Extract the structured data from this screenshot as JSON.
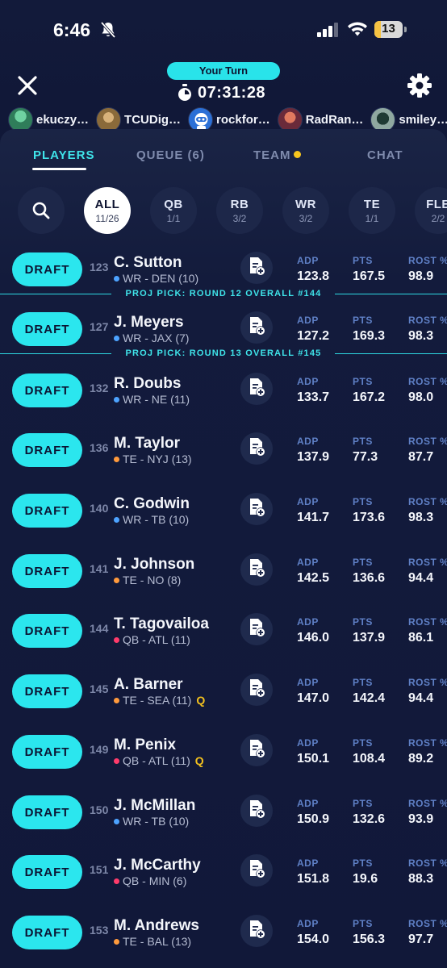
{
  "status_bar": {
    "time": "6:46",
    "battery": "13"
  },
  "header": {
    "turn_label": "Your Turn",
    "timer": "07:31:28"
  },
  "drafters": [
    {
      "name": "ekuczy…",
      "color": "#2f7d5a"
    },
    {
      "name": "TCUDig…",
      "color": "#8a6a3a"
    },
    {
      "name": "rockfor…",
      "color": "#2b6fd6"
    },
    {
      "name": "RadRan…",
      "color": "#b04a3a"
    },
    {
      "name": "smiley…",
      "color": "#3a6a5a"
    }
  ],
  "tabs": {
    "players": "PLAYERS",
    "queue": "QUEUE (6)",
    "team": "TEAM",
    "chat": "CHAT"
  },
  "filters": [
    {
      "label": "ALL",
      "count": "11/26",
      "active": true
    },
    {
      "label": "QB",
      "count": "1/1"
    },
    {
      "label": "RB",
      "count": "3/2"
    },
    {
      "label": "WR",
      "count": "3/2"
    },
    {
      "label": "TE",
      "count": "1/1"
    },
    {
      "label": "FLE",
      "count": "2/2"
    }
  ],
  "stat_labels": {
    "adp": "ADP",
    "pts": "PTS",
    "rost": "ROST %"
  },
  "draft_label": "DRAFT",
  "proj_picks": [
    "PROJ PICK: ROUND 12 OVERALL #144",
    "PROJ PICK: ROUND 13 OVERALL #145"
  ],
  "position_colors": {
    "WR": "#4da3ff",
    "TE": "#ff9a3c",
    "QB": "#ff3b6b"
  },
  "players": [
    {
      "rank": "123",
      "name": "C. Sutton",
      "pos": "WR",
      "team": "DEN",
      "bye": "(10)",
      "adp": "123.8",
      "pts": "167.5",
      "rost": "98.9"
    },
    {
      "rank": "127",
      "name": "J. Meyers",
      "pos": "WR",
      "team": "JAX",
      "bye": "(7)",
      "adp": "127.2",
      "pts": "169.3",
      "rost": "98.3"
    },
    {
      "rank": "132",
      "name": "R. Doubs",
      "pos": "WR",
      "team": "NE",
      "bye": "(11)",
      "adp": "133.7",
      "pts": "167.2",
      "rost": "98.0"
    },
    {
      "rank": "136",
      "name": "M. Taylor",
      "pos": "TE",
      "team": "NYJ",
      "bye": "(13)",
      "adp": "137.9",
      "pts": "77.3",
      "rost": "87.7"
    },
    {
      "rank": "140",
      "name": "C. Godwin",
      "pos": "WR",
      "team": "TB",
      "bye": "(10)",
      "adp": "141.7",
      "pts": "173.6",
      "rost": "98.3"
    },
    {
      "rank": "141",
      "name": "J. Johnson",
      "pos": "TE",
      "team": "NO",
      "bye": "(8)",
      "adp": "142.5",
      "pts": "136.6",
      "rost": "94.4"
    },
    {
      "rank": "144",
      "name": "T. Tagovailoa",
      "pos": "QB",
      "team": "ATL",
      "bye": "(11)",
      "adp": "146.0",
      "pts": "137.9",
      "rost": "86.1"
    },
    {
      "rank": "145",
      "name": "A. Barner",
      "pos": "TE",
      "team": "SEA",
      "bye": "(11)",
      "tag": "Q",
      "adp": "147.0",
      "pts": "142.4",
      "rost": "94.4"
    },
    {
      "rank": "149",
      "name": "M. Penix",
      "pos": "QB",
      "team": "ATL",
      "bye": "(11)",
      "tag": "Q",
      "adp": "150.1",
      "pts": "108.4",
      "rost": "89.2"
    },
    {
      "rank": "150",
      "name": "J. McMillan",
      "pos": "WR",
      "team": "TB",
      "bye": "(10)",
      "adp": "150.9",
      "pts": "132.6",
      "rost": "93.9"
    },
    {
      "rank": "151",
      "name": "J. McCarthy",
      "pos": "QB",
      "team": "MIN",
      "bye": "(6)",
      "adp": "151.8",
      "pts": "19.6",
      "rost": "88.3"
    },
    {
      "rank": "153",
      "name": "M. Andrews",
      "pos": "TE",
      "team": "BAL",
      "bye": "(13)",
      "adp": "154.0",
      "pts": "156.3",
      "rost": "97.7"
    }
  ]
}
